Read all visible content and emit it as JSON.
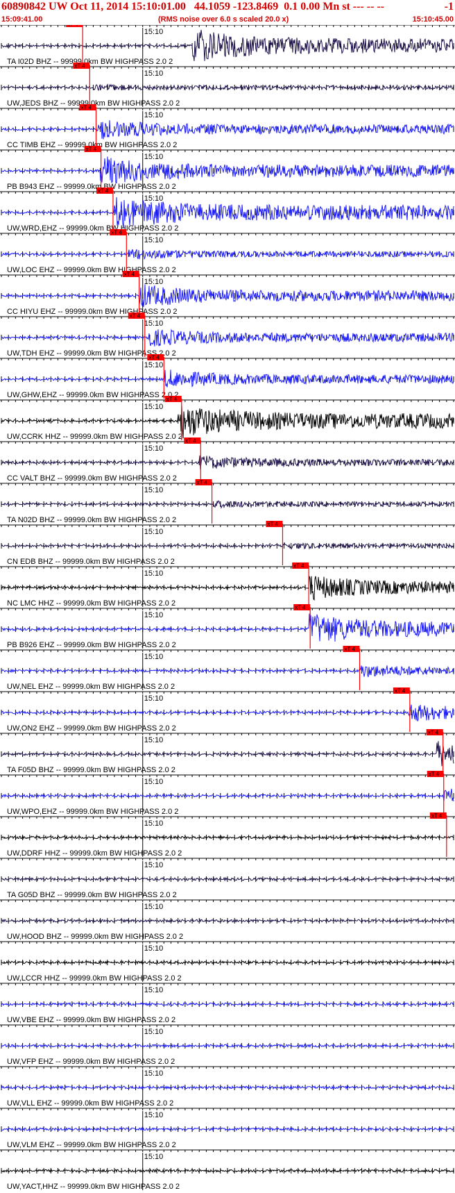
{
  "header": {
    "title": "60890842 UW Oct 11, 2014 15:10:01.00   44.1059 -123.8469  0.1 0.00 Mn st --- -- --",
    "right_mark": "-1",
    "start_time": "15:09:41.00",
    "subtitle": "(RMS noise over 6.0 s scaled 20.0 x)",
    "end_time": "15:10:45.00"
  },
  "colors": {
    "header": "#d40000",
    "marker": "#ff0000",
    "blue_trace": "#1a1aff",
    "dark_trace": "#1c0f4a",
    "black_trace": "#000000"
  },
  "chart_data": {
    "type": "line",
    "title": "60890842 UW Oct 11, 2014 15:10:01.00   44.1059 -123.8469  0.1 0.00 Mn st --- -- --",
    "xlabel": "",
    "ylabel": "",
    "x_range": [
      "15:09:41.00",
      "15:10:45.00"
    ],
    "tick_label": "15:10",
    "phase_label": "xT 4",
    "traces": [
      {
        "station": "TA.I02D.BHZ",
        "label": "TA I02D BHZ -- 99999.0km BW  HIGHPASS  2.0  2",
        "color": "dark",
        "pick_time": 11.5,
        "onset": 27,
        "amp": 0.95
      },
      {
        "station": "UW.JEDS.BHZ",
        "label": "UW,JEDS BHZ -- 99999.0km BW  HIGHPASS  2.0  2",
        "color": "dark",
        "pick_time": 12.5,
        "onset": 13,
        "amp": 0.12
      },
      {
        "station": "CC.TIMB.EHZ",
        "label": "CC TIMB EHZ -- 99999.0km BW  HIGHPASS  2.0  2",
        "color": "blue",
        "pick_time": 13.4,
        "onset": 13.5,
        "amp": 0.55
      },
      {
        "station": "PB.B943.EHZ",
        "label": "PB B943 EHZ -- 99999.0km BW  HIGHPASS  2.0  2",
        "color": "blue",
        "pick_time": 14.1,
        "onset": 14,
        "amp": 0.8
      },
      {
        "station": "UW.WRD.EHZ",
        "label": "UW,WRD,EHZ -- 99999.0km BW  HIGHPASS  2.0  2",
        "color": "blue",
        "pick_time": 15.8,
        "onset": 16,
        "amp": 1.0
      },
      {
        "station": "UW.LOC.EHZ",
        "label": "UW,LOC EHZ -- 99999.0km BW  HIGHPASS  2.0  2",
        "color": "blue",
        "pick_time": 17.7,
        "onset": 18,
        "amp": 0.25
      },
      {
        "station": "CC.HIYU.EHZ",
        "label": "CC HIYU EHZ -- 99999.0km BW  HIGHPASS  2.0  2",
        "color": "blue",
        "pick_time": 19.5,
        "onset": 19.5,
        "amp": 0.65
      },
      {
        "station": "UW.TDH.EHZ",
        "label": "UW,TDH EHZ -- 99999.0km BW  HIGHPASS  2.0  2",
        "color": "blue",
        "pick_time": 20.3,
        "onset": 20.5,
        "amp": 0.5
      },
      {
        "station": "UW.GHW.EHZ",
        "label": "UW,GHW,EHZ -- 99999.0km BW  HIGHPASS  2.0  2",
        "color": "blue",
        "pick_time": 23.0,
        "onset": 23,
        "amp": 0.5
      },
      {
        "station": "UW.CCRK.HHZ",
        "label": "UW,CCRK HHZ -- 99999.0km BW  HIGHPASS  2.0  2",
        "color": "black",
        "pick_time": 25.5,
        "onset": 25,
        "amp": 1.0
      },
      {
        "station": "CC.VALT.BHZ",
        "label": "CC VALT BHZ -- 99999.0km BW  HIGHPASS  2.0  2",
        "color": "dark",
        "pick_time": 28.2,
        "onset": 28,
        "amp": 0.35
      },
      {
        "station": "TA.N02D.BHZ",
        "label": "TA N02D BHZ -- 99999.0km BW  HIGHPASS  2.0  2",
        "color": "dark",
        "pick_time": 29.8,
        "onset": 30,
        "amp": 0.15
      },
      {
        "station": "CN.EDB.BHZ",
        "label": "CN EDB BHZ -- 99999.0km BW  HIGHPASS  2.0  2",
        "color": "dark",
        "pick_time": 39.8,
        "onset": 40,
        "amp": 0.12
      },
      {
        "station": "NC.LMC.HHZ",
        "label": "NC LMC HHZ -- 99999.0km BW  HIGHPASS  2.0  2",
        "color": "black",
        "pick_time": 43.5,
        "onset": 43.5,
        "amp": 0.7
      },
      {
        "station": "PB.B926.EHZ",
        "label": "PB B926 EHZ -- 99999.0km BW  HIGHPASS  2.0  2",
        "color": "blue",
        "pick_time": 43.7,
        "onset": 43.5,
        "amp": 0.9
      },
      {
        "station": "UW.NEL.EHZ",
        "label": "UW,NEL EHZ -- 99999.0km BW  HIGHPASS  2.0  2",
        "color": "blue",
        "pick_time": 50.7,
        "onset": 50.5,
        "amp": 0.35
      },
      {
        "station": "UW.ON2.EHZ",
        "label": "UW,ON2 EHZ -- 99999.0km BW  HIGHPASS  2.0  2",
        "color": "blue",
        "pick_time": 57.8,
        "onset": 57.5,
        "amp": 0.5
      },
      {
        "station": "TA.F05D.BHZ",
        "label": "TA F05D BHZ -- 99999.0km BW  HIGHPASS  2.0  2",
        "color": "dark",
        "pick_time": 62.5,
        "onset": 61.5,
        "amp": 0.7
      },
      {
        "station": "UW.WPO.EHZ",
        "label": "UW,WPO,EHZ -- 99999.0km BW  HIGHPASS  2.0  2",
        "color": "blue",
        "pick_time": 62.6,
        "onset": 62.5,
        "amp": 0.45
      },
      {
        "station": "UW.DDRF.HHZ",
        "label": "UW,DDRF HHZ -- 99999.0km BW  HIGHPASS  2.0  2",
        "color": "black",
        "pick_time": 63.0,
        "onset": null,
        "amp": 0.0
      },
      {
        "station": "TA.G05D.BHZ",
        "label": "TA G05D BHZ -- 99999.0km BW  HIGHPASS  2.0  2",
        "color": "dark",
        "pick_time": null,
        "onset": null,
        "amp": 0.0
      },
      {
        "station": "UW.HOOD.BHZ",
        "label": "UW,HOOD BHZ -- 99999.0km BW  HIGHPASS  2.0  2",
        "color": "dark",
        "pick_time": null,
        "onset": null,
        "amp": 0.0
      },
      {
        "station": "UW.LCCR.HHZ",
        "label": "UW,LCCR HHZ -- 99999.0km BW  HIGHPASS  2.0  2",
        "color": "black",
        "pick_time": null,
        "onset": null,
        "amp": 0.0
      },
      {
        "station": "UW.VBE.EHZ",
        "label": "UW,VBE EHZ -- 99999.0km BW  HIGHPASS  2.0  2",
        "color": "blue",
        "pick_time": null,
        "onset": null,
        "amp": 0.0
      },
      {
        "station": "UW.VFP.EHZ",
        "label": "UW,VFP EHZ -- 99999.0km BW  HIGHPASS  2.0  2",
        "color": "blue",
        "pick_time": null,
        "onset": null,
        "amp": 0.0
      },
      {
        "station": "UW.VLL.EHZ",
        "label": "UW,VLL EHZ -- 99999.0km BW  HIGHPASS  2.0  2",
        "color": "blue",
        "pick_time": null,
        "onset": null,
        "amp": 0.0
      },
      {
        "station": "UW.VLM.EHZ",
        "label": "UW,VLM EHZ -- 99999.0km BW  HIGHPASS  2.0  2",
        "color": "blue",
        "pick_time": null,
        "onset": null,
        "amp": 0.0
      },
      {
        "station": "UW.YACT.HHZ",
        "label": "UW,YACT,HHZ -- 99999.0km BW  HIGHPASS  2.0  2",
        "color": "black",
        "pick_time": null,
        "onset": null,
        "amp": 0.0
      }
    ]
  }
}
